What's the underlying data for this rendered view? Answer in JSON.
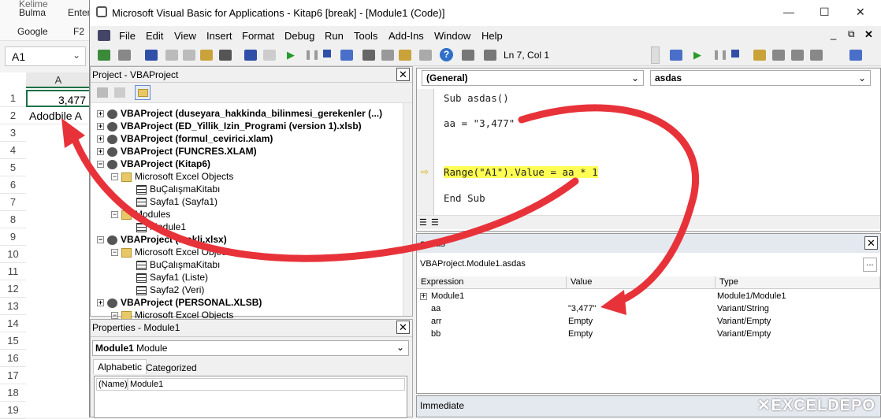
{
  "excel": {
    "ribbon": {
      "find": "Kelime\nBulma",
      "find_group": "Google",
      "enter": "F2\nEnter",
      "f2": "F2"
    },
    "namebox": "A1",
    "column_header": "A",
    "rows": [
      "1",
      "2",
      "3",
      "4",
      "5",
      "6",
      "7",
      "8",
      "9",
      "10",
      "11",
      "12",
      "13",
      "14",
      "15",
      "16",
      "17",
      "18",
      "19"
    ],
    "cells": {
      "a1": "3,477",
      "a2": "Adodbile A"
    }
  },
  "vbe": {
    "title": "Microsoft Visual Basic for Applications - Kitap6 [break] - [Module1 (Code)]",
    "menus": [
      "File",
      "Edit",
      "View",
      "Insert",
      "Format",
      "Debug",
      "Run",
      "Tools",
      "Add-Ins",
      "Window",
      "Help"
    ],
    "cursor_pos": "Ln 7, Col 1",
    "project": {
      "title": "Project - VBAProject",
      "items": [
        {
          "label": "VBAProject (duseyara_hakkinda_bilinmesi_gerekenler (...)",
          "level": 0,
          "bold": true,
          "icon": "project-icon",
          "toggle": "+"
        },
        {
          "label": "VBAProject (ED_Yillik_Izin_Programi (version 1).xlsb)",
          "level": 0,
          "bold": true,
          "icon": "project-icon",
          "toggle": "+"
        },
        {
          "label": "VBAProject (formul_cevirici.xlam)",
          "level": 0,
          "bold": true,
          "icon": "project-icon",
          "toggle": "+"
        },
        {
          "label": "VBAProject (FUNCRES.XLAM)",
          "level": 0,
          "bold": true,
          "icon": "project-icon",
          "toggle": "+"
        },
        {
          "label": "VBAProject (Kitap6)",
          "level": 0,
          "bold": true,
          "icon": "project-icon",
          "toggle": "-"
        },
        {
          "label": "Microsoft Excel Objects",
          "level": 1,
          "bold": false,
          "icon": "folder-icon",
          "toggle": "-"
        },
        {
          "label": "BuÇalışmaKitabı",
          "level": 2,
          "bold": false,
          "icon": "workbook-icon",
          "toggle": ""
        },
        {
          "label": "Sayfa1 (Sayfa1)",
          "level": 2,
          "bold": false,
          "icon": "sheet-icon",
          "toggle": ""
        },
        {
          "label": "Modules",
          "level": 1,
          "bold": false,
          "icon": "folder-icon",
          "toggle": "-"
        },
        {
          "label": "Module1",
          "level": 2,
          "bold": false,
          "icon": "module-icon",
          "toggle": ""
        },
        {
          "label": "VBAProject (makli.xlsx)",
          "level": 0,
          "bold": true,
          "icon": "project-icon",
          "toggle": "-"
        },
        {
          "label": "Microsoft Excel Objects",
          "level": 1,
          "bold": false,
          "icon": "folder-icon",
          "toggle": "-"
        },
        {
          "label": "BuÇalışmaKitabı",
          "level": 2,
          "bold": false,
          "icon": "workbook-icon",
          "toggle": ""
        },
        {
          "label": "Sayfa1 (Liste)",
          "level": 2,
          "bold": false,
          "icon": "sheet-icon",
          "toggle": ""
        },
        {
          "label": "Sayfa2 (Veri)",
          "level": 2,
          "bold": false,
          "icon": "sheet-icon",
          "toggle": ""
        },
        {
          "label": "VBAProject (PERSONAL.XLSB)",
          "level": 0,
          "bold": true,
          "icon": "project-icon",
          "toggle": "+"
        },
        {
          "label": "Microsoft Excel Objects",
          "level": 1,
          "bold": false,
          "icon": "folder-icon",
          "toggle": "-"
        }
      ]
    },
    "properties": {
      "title": "Properties - Module1",
      "object": "Module1",
      "object_type": "Module",
      "tabs": [
        "Alphabetic",
        "Categorized"
      ],
      "row": {
        "name": "(Name)",
        "value": "Module1"
      }
    },
    "code": {
      "object_combo": "(General)",
      "proc_combo": "asdas",
      "lines": [
        "Sub asdas()",
        "aa = \"3,477\"",
        "Range(\"A1\").Value = aa * 1",
        "End Sub"
      ]
    },
    "watches": {
      "title": "asdas",
      "context": "VBAProject.Module1.asdas",
      "columns": [
        "Expression",
        "Value",
        "Type"
      ],
      "rows": [
        {
          "expr": "Module1",
          "value": "",
          "type": "Module1/Module1"
        },
        {
          "expr": "aa",
          "value": "\"3,477\"",
          "type": "Variant/String"
        },
        {
          "expr": "arr",
          "value": "Empty",
          "type": "Variant/Empty"
        },
        {
          "expr": "bb",
          "value": "Empty",
          "type": "Variant/Empty"
        }
      ]
    },
    "immediate": {
      "title": "Immediate"
    },
    "logo": "EXCELDEPO"
  },
  "colors": {
    "highlight": "#ffff54",
    "arrow": "#e8323a",
    "excel_green": "#1e7145"
  }
}
